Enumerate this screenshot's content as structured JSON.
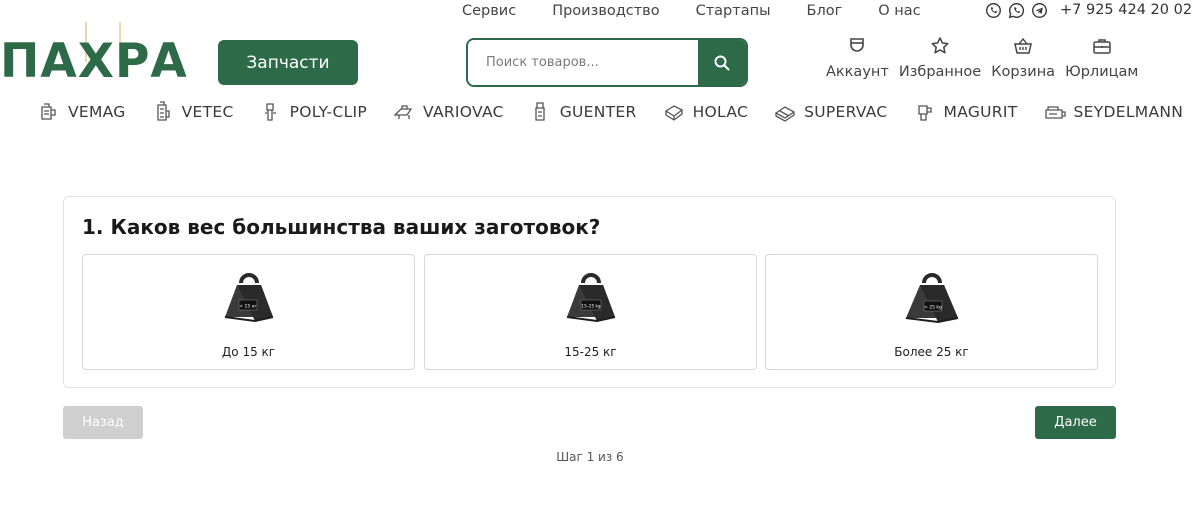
{
  "colors": {
    "brand_green": "#2d6a47",
    "disabled_grey": "#cfcfcf"
  },
  "top_nav": [
    "Сервис",
    "Производство",
    "Стартапы",
    "Блог",
    "О нас"
  ],
  "contacts": {
    "icons": [
      "viber-icon",
      "whatsapp-icon",
      "telegram-icon"
    ],
    "phone": "+7 925 424 20 02"
  },
  "logo": {
    "text": "ПАХРА"
  },
  "parts_button": "Запчасти",
  "search": {
    "placeholder": "Поиск товаров..."
  },
  "header_icons": [
    {
      "icon": "account-icon",
      "label": "Аккаунт"
    },
    {
      "icon": "star-icon",
      "label": "Избранное"
    },
    {
      "icon": "basket-icon",
      "label": "Корзина"
    },
    {
      "icon": "briefcase-icon",
      "label": "Юрлицам"
    }
  ],
  "brands": [
    "VEMAG",
    "VETEC",
    "POLY-CLIP",
    "VARIOVAC",
    "GUENTER",
    "HOLAC",
    "SUPERVAC",
    "MAGURIT",
    "SEYDELMANN"
  ],
  "quiz": {
    "question": "1. Каков вес большинства ваших заготовок?",
    "options": [
      {
        "label": "До 15 кг",
        "weight_tag": "< 15 кг"
      },
      {
        "label": "15-25 кг",
        "weight_tag": "15–25 kg"
      },
      {
        "label": "Более 25 кг",
        "weight_tag": "> 25 kg"
      }
    ],
    "back": "Назад",
    "next": "Далее",
    "step": "Шаг 1 из 6"
  }
}
